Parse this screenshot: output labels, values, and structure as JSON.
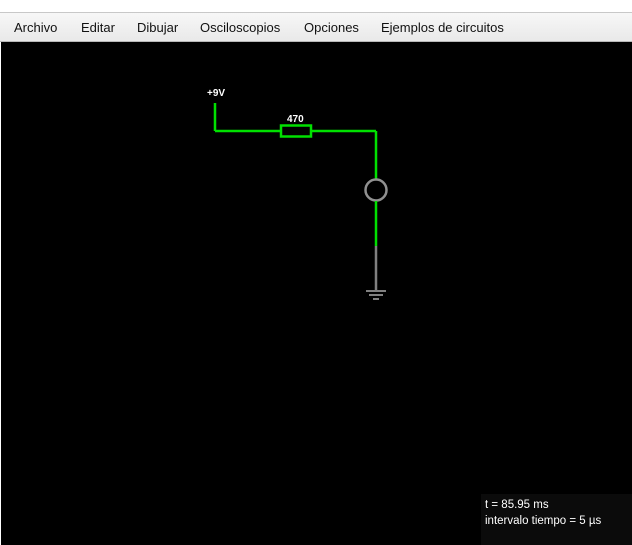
{
  "menu": {
    "items": [
      {
        "label": "Archivo"
      },
      {
        "label": "Editar"
      },
      {
        "label": "Dibujar"
      },
      {
        "label": "Osciloscopios"
      },
      {
        "label": "Opciones"
      },
      {
        "label": "Ejemplos de circuitos"
      }
    ]
  },
  "circuit": {
    "voltage_label": "+9V",
    "resistor_label": "470",
    "wire_color": "#00e000",
    "ground_color": "#808080",
    "background": "#000000"
  },
  "status": {
    "time_text": "t = 85.95 ms",
    "interval_text": "intervalo tiempo = 5 µs"
  }
}
